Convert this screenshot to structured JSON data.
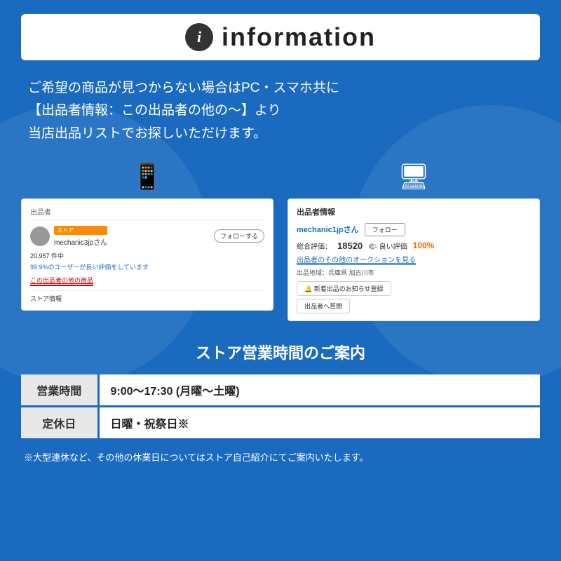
{
  "header": {
    "icon_label": "i",
    "title": "information"
  },
  "main_text": {
    "line1": "ご希望の商品が見つからない場合はPC・スマホ共に",
    "line2": "【出品者情報：この出品者の他の〜】より",
    "line3": "当店出品リストでお探しいただけます。"
  },
  "mobile_mock": {
    "section_label": "出品者",
    "store_badge": "ストア",
    "seller_name": "mechanic3jpさん",
    "follow_btn": "フォローする",
    "count": "20,957 件中",
    "rating_text": "99.9%のユーザーが良い評価をしています",
    "link": "この出品者の他の商品",
    "store_info": "ストア情報"
  },
  "pc_mock": {
    "section_label": "出品者情報",
    "seller_name": "mechanic1jpさん",
    "follow_btn": "フォロー",
    "total_label": "総合評価：",
    "total_num": "18520",
    "good_label": "🌤 良い評価",
    "good_pct": "100%",
    "auction_link": "出品者のその他のオークションを見る",
    "location": "出品地域：兵庫県 加古川市",
    "notify_btn": "🔔 新着出品のお知らせ登録",
    "question_btn": "出品者へ質問"
  },
  "store_hours": {
    "title": "ストア営業時間のご案内",
    "rows": [
      {
        "label": "営業時間",
        "value": "9:00〜17:30 (月曜〜土曜)"
      },
      {
        "label": "定休日",
        "value": "日曜・祝祭日※"
      }
    ],
    "footnote": "※大型連休など、その他の休業日についてはストア自己紹介にてご案内いたします。"
  },
  "icons": {
    "mobile": "📱",
    "desktop": "🖥"
  }
}
